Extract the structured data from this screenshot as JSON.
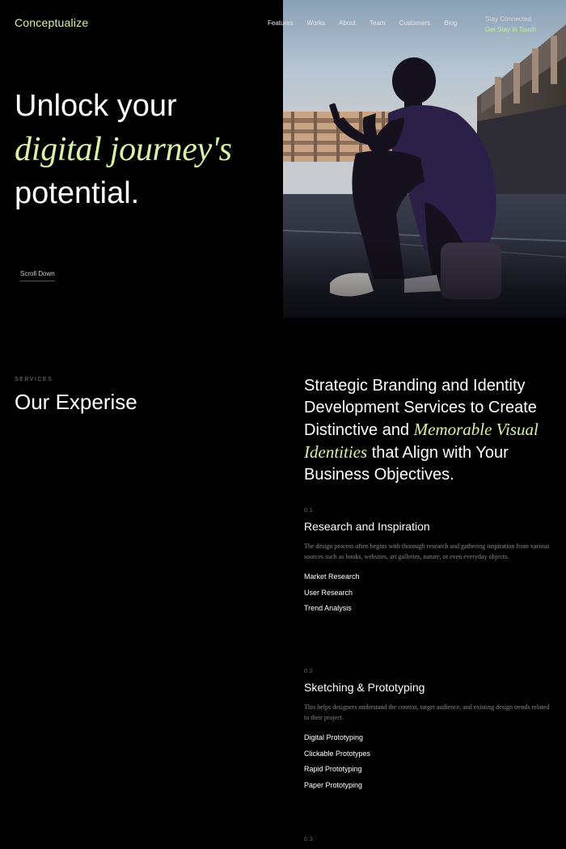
{
  "header": {
    "logo": "Conceptualize",
    "nav": [
      "Features",
      "Works",
      "About",
      "Team",
      "Customers",
      "Blog"
    ],
    "stay_label": "Stay Connected",
    "contact_link": "Get Stay in Touch"
  },
  "hero": {
    "line1": "Unlock your",
    "line2_accent": "digital journey's",
    "line3": "potential.",
    "scroll_label": "Scroll Down"
  },
  "services": {
    "tag": "SERVICES",
    "title": "Our Experise",
    "lead_part1": "Strategic Branding and Identity Development Services to Create Distinctive and ",
    "lead_accent": "Memorable Visual Identities",
    "lead_part2": " that Align with Your Business Objectives.",
    "steps": [
      {
        "num": "0.1",
        "title": "Research and Inspiration",
        "desc": "The design process often begins with thorough research and gathering inspiration from various sources such as books, websites, art galleries, nature, or even everyday objects.",
        "items": [
          "Market Research",
          "User Research",
          "Trend Analysis"
        ]
      },
      {
        "num": "0.2",
        "title": "Sketching & Prototyping",
        "desc": "This helps designers understand the context, target audience, and existing design trends related to their project.",
        "items": [
          "Digital Prototyping",
          "Clickable Prototypes",
          "Rapid Prototyping",
          "Paper Prototyping"
        ]
      },
      {
        "num": "0.3"
      }
    ]
  },
  "colors": {
    "accent": "#d7f3a7",
    "background": "#000000"
  }
}
